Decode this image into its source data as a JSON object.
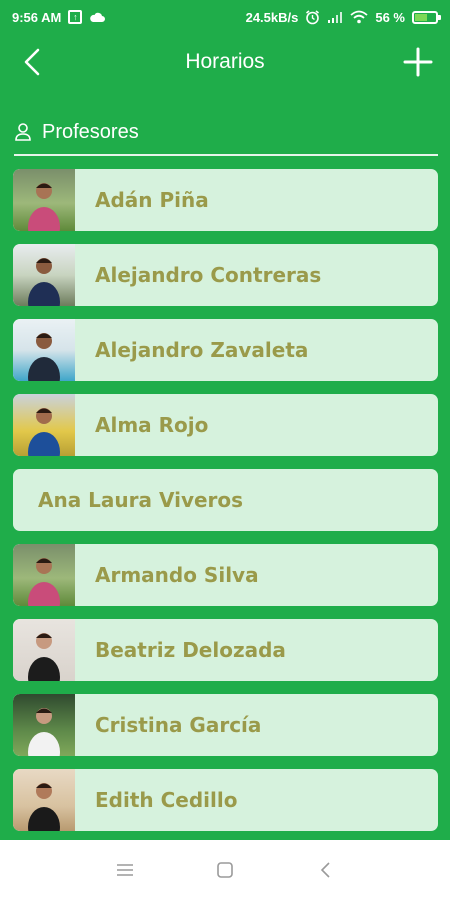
{
  "status_bar": {
    "time": "9:56 AM",
    "speed": "24.5kB/s",
    "battery_percent": "56 %",
    "battery_level": 0.56,
    "icons": [
      "upload-icon",
      "cloud-icon",
      "alarm-icon",
      "signal-icon",
      "wifi-icon",
      "battery-icon"
    ]
  },
  "app_bar": {
    "title": "Horarios",
    "back_icon": "chevron-left-icon",
    "add_icon": "plus-icon"
  },
  "section": {
    "title": "Profesores",
    "icon": "person-icon"
  },
  "professors": [
    {
      "name": "Adán Piña",
      "has_photo": true,
      "photo": "man-outdoor-grass"
    },
    {
      "name": "Alejandro Contreras",
      "has_photo": true,
      "photo": "man-outdoor-tree"
    },
    {
      "name": "Alejandro Zavaleta",
      "has_photo": true,
      "photo": "man-pool"
    },
    {
      "name": "Alma Rojo",
      "has_photo": true,
      "photo": "woman-court"
    },
    {
      "name": "Ana Laura Viveros",
      "has_photo": false
    },
    {
      "name": "Armando Silva",
      "has_photo": true,
      "photo": "man-outdoor-grass"
    },
    {
      "name": "Beatriz Delozada",
      "has_photo": true,
      "photo": "woman-studio"
    },
    {
      "name": "Cristina García",
      "has_photo": true,
      "photo": "woman-park"
    },
    {
      "name": "Edith Cedillo",
      "has_photo": true,
      "photo": "woman-dance"
    }
  ],
  "colors": {
    "background": "#1fad4a",
    "card": "#d6f2dd",
    "name_text": "#9a9a4a"
  },
  "nav_bar": {
    "icons": [
      "menu-icon",
      "home-square-icon",
      "back-triangle-icon"
    ]
  }
}
